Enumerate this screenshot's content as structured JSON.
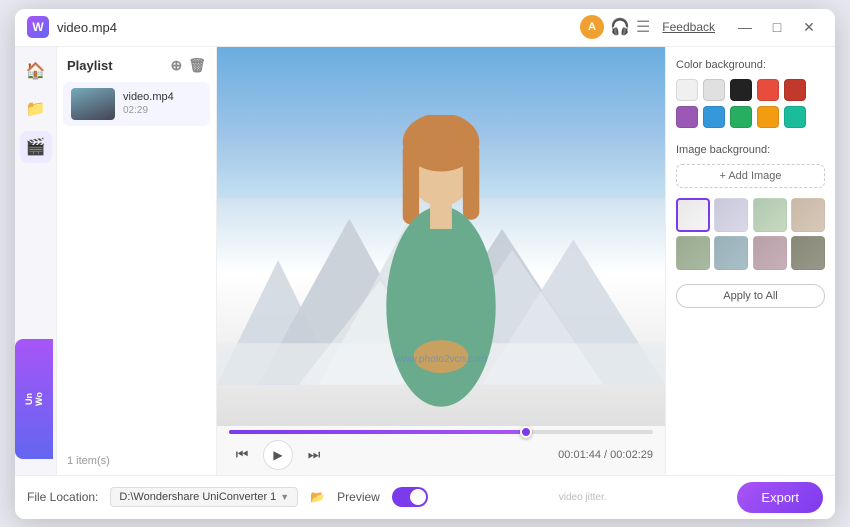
{
  "titleBar": {
    "title": "video.mp4",
    "feedback": "Feedback",
    "appIcon": "W",
    "userIcon": "A",
    "headphoneIcon": "🎧",
    "minimizeBtn": "—",
    "maximizeBtn": "□",
    "closeBtn": "✕"
  },
  "leftNav": {
    "icons": [
      "🏠",
      "📁",
      "🎬"
    ]
  },
  "playlist": {
    "title": "Playlist",
    "item": {
      "name": "video.mp4",
      "duration": "02:29"
    },
    "count": "1 item(s)"
  },
  "video": {
    "watermark": "www.photo2vcn.com",
    "currentTime": "00:01:44",
    "totalTime": "00:02:29",
    "progressPercent": 70
  },
  "bottomBar": {
    "fileLocationLabel": "File Location:",
    "filePath": "D:\\Wondershare UniConverter 1",
    "previewLabel": "Preview",
    "toggleOn": true,
    "scrollHint": "video jitter."
  },
  "rightPanel": {
    "colorBgTitle": "Color background:",
    "colors": [
      {
        "hex": "#f0f0f0",
        "label": "light-gray"
      },
      {
        "hex": "#e0e0e0",
        "label": "gray"
      },
      {
        "hex": "#222222",
        "label": "black"
      },
      {
        "hex": "#e74c3c",
        "label": "red"
      },
      {
        "hex": "#c0392b",
        "label": "dark-red"
      },
      {
        "hex": "#9b59b6",
        "label": "purple"
      },
      {
        "hex": "#3498db",
        "label": "blue"
      },
      {
        "hex": "#27ae60",
        "label": "green"
      },
      {
        "hex": "#f39c12",
        "label": "orange"
      },
      {
        "hex": "#1abc9c",
        "label": "teal"
      }
    ],
    "imageBgTitle": "Image background:",
    "addImageBtn": "+ Add Image",
    "bgImages": [
      {
        "color1": "#e8e8e8",
        "color2": "#f5f5f5",
        "selected": true
      },
      {
        "color1": "#c8c8d8",
        "color2": "#d8d8e8",
        "selected": false
      },
      {
        "color1": "#d0d8d0",
        "color2": "#e0e8e0",
        "selected": false
      },
      {
        "color1": "#d8c8c0",
        "color2": "#e8d8d0",
        "selected": false
      },
      {
        "color1": "#c0c8b0",
        "color2": "#d0d8c0",
        "selected": false
      },
      {
        "color1": "#b0c0c8",
        "color2": "#c0d0d8",
        "selected": false
      },
      {
        "color1": "#c8b0b8",
        "color2": "#d8c0c8",
        "selected": false
      },
      {
        "color1": "#b8b8b0",
        "color2": "#c8c8c0",
        "selected": false
      }
    ],
    "applyAllBtn": "Apply to All",
    "exportBtn": "Export"
  },
  "banner": {
    "line1": "Wo",
    "line2": "Un"
  }
}
